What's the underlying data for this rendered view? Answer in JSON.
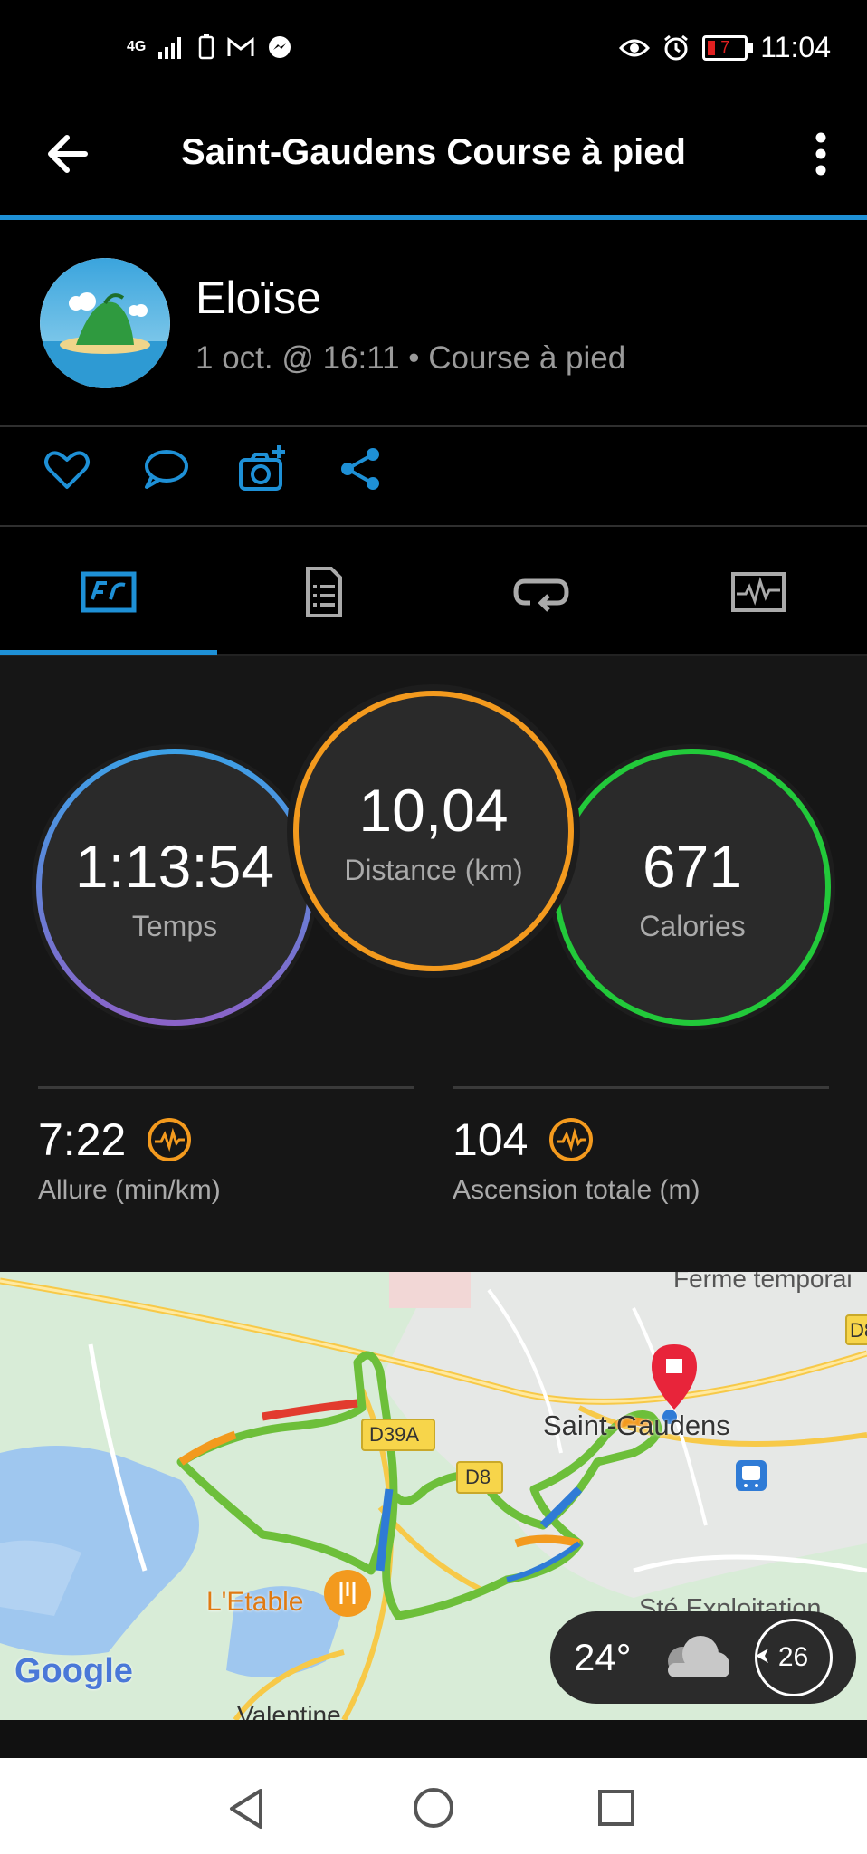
{
  "status_bar": {
    "network": "4G",
    "time": "11:04",
    "battery": "7"
  },
  "header": {
    "title": "Saint-Gaudens Course à pied"
  },
  "profile": {
    "name": "Eloïse",
    "meta": "1 oct. @ 16:11 • Course à pied"
  },
  "actions": [
    "heart-icon",
    "comment-icon",
    "camera-add-icon",
    "share-icon"
  ],
  "tabs": [
    "overview-icon",
    "details-icon",
    "laps-icon",
    "charts-icon"
  ],
  "stats": {
    "time": {
      "value": "1:13:54",
      "label": "Temps",
      "color": "#3b8fe0"
    },
    "distance": {
      "value": "10,04",
      "label": "Distance (km)",
      "color": "#f39a1e"
    },
    "calories": {
      "value": "671",
      "label": "Calories",
      "color": "#22c93a"
    },
    "pace": {
      "value": "7:22",
      "label": "Allure (min/km)"
    },
    "ascent": {
      "value": "104",
      "label": "Ascension totale (m)"
    }
  },
  "map": {
    "labels": {
      "town": "Saint-Gaudens",
      "road1": "D39A",
      "road2": "D8",
      "road3": "D8",
      "farm": "Ferme temporai",
      "restaurant": "L'Etable",
      "company": "Sté Exploitation",
      "town2": "Valentine",
      "google": "Google"
    },
    "weather": {
      "temp": "24°",
      "wind": "26"
    }
  }
}
